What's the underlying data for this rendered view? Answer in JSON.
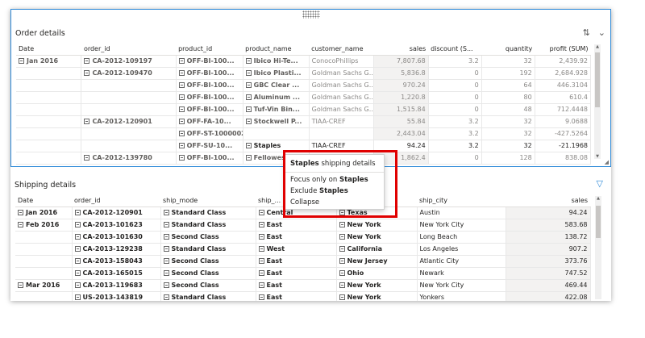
{
  "order_details": {
    "title": "Order details",
    "columns": [
      "Date",
      "order_id",
      "product_id",
      "product_name",
      "customer_name",
      "sales",
      "discount (S...",
      "quantity",
      "profit (SUM)"
    ],
    "rows": [
      {
        "date": "Jan 2016",
        "order_id": "CA-2012-109197",
        "product_id": "OFF-BI-100...",
        "product_name": "Ibico Hi-Te...",
        "customer_name": "ConocoPhillips",
        "sales": "7,807.68",
        "discount": "3.2",
        "quantity": "32",
        "profit": "2,439.92"
      },
      {
        "date": "",
        "order_id": "CA-2012-109470",
        "product_id": "OFF-BI-100...",
        "product_name": "Ibico Plasti...",
        "customer_name": "Goldman Sachs G...",
        "sales": "5,836.8",
        "discount": "0",
        "quantity": "192",
        "profit": "2,684.928"
      },
      {
        "date": "",
        "order_id": "",
        "product_id": "OFF-BI-100...",
        "product_name": "GBC Clear ...",
        "customer_name": "Goldman Sachs G...",
        "sales": "970.24",
        "discount": "0",
        "quantity": "64",
        "profit": "446.3104"
      },
      {
        "date": "",
        "order_id": "",
        "product_id": "OFF-BI-100...",
        "product_name": "Aluminum ...",
        "customer_name": "Goldman Sachs G...",
        "sales": "1,220.8",
        "discount": "0",
        "quantity": "80",
        "profit": "610.4"
      },
      {
        "date": "",
        "order_id": "",
        "product_id": "OFF-BI-100...",
        "product_name": "Tuf-Vin Bin...",
        "customer_name": "Goldman Sachs G...",
        "sales": "1,515.84",
        "discount": "0",
        "quantity": "48",
        "profit": "712.4448"
      },
      {
        "date": "",
        "order_id": "CA-2012-120901",
        "product_id": "OFF-FA-10...",
        "product_name": "Stockwell P...",
        "customer_name": "TIAA-CREF",
        "sales": "55.84",
        "discount": "3.2",
        "quantity": "32",
        "profit": "9.0688"
      },
      {
        "date": "",
        "order_id": "",
        "product_id": "OFF-ST-10000025",
        "product_name": "",
        "customer_name": "",
        "sales": "2,443.04",
        "discount": "3.2",
        "quantity": "32",
        "profit": "-427.5264"
      },
      {
        "date": "",
        "order_id": "",
        "product_id": "OFF-SU-10...",
        "product_name": "Staples",
        "customer_name": "TIAA-CREF",
        "sales": "94.24",
        "discount": "3.2",
        "quantity": "32",
        "profit": "-21.1968"
      },
      {
        "date": "",
        "order_id": "CA-2012-139780",
        "product_id": "OFF-BI-100...",
        "product_name": "Fellowes...",
        "customer_name": "",
        "sales": "1,862.4",
        "discount": "0",
        "quantity": "128",
        "profit": "838.08"
      }
    ]
  },
  "shipping_details": {
    "title": "Shipping details",
    "columns": [
      "Date",
      "order_id",
      "ship_mode",
      "ship_...",
      "",
      "ship_city",
      "sales"
    ],
    "rows": [
      {
        "date": "Jan 2016",
        "order_id": "CA-2012-120901",
        "ship_mode": "Standard Class",
        "region": "Central",
        "state": "Texas",
        "city": "Austin",
        "sales": "94.24"
      },
      {
        "date": "Feb 2016",
        "order_id": "CA-2013-101623",
        "ship_mode": "Standard Class",
        "region": "East",
        "state": "New York",
        "city": "New York City",
        "sales": "583.68"
      },
      {
        "date": "",
        "order_id": "CA-2013-101630",
        "ship_mode": "Second Class",
        "region": "East",
        "state": "New York",
        "city": "Long Beach",
        "sales": "138.72"
      },
      {
        "date": "",
        "order_id": "CA-2013-129238",
        "ship_mode": "Standard Class",
        "region": "West",
        "state": "California",
        "city": "Los Angeles",
        "sales": "907.2"
      },
      {
        "date": "",
        "order_id": "CA-2013-158043",
        "ship_mode": "Second Class",
        "region": "East",
        "state": "New Jersey",
        "city": "Atlantic City",
        "sales": "373.76"
      },
      {
        "date": "",
        "order_id": "CA-2013-165015",
        "ship_mode": "Second Class",
        "region": "East",
        "state": "Ohio",
        "city": "Newark",
        "sales": "747.52"
      },
      {
        "date": "Mar 2016",
        "order_id": "CA-2013-119683",
        "ship_mode": "Second Class",
        "region": "East",
        "state": "New York",
        "city": "New York City",
        "sales": "469.44"
      },
      {
        "date": "",
        "order_id": "US-2013-143819",
        "ship_mode": "Standard Class",
        "region": "East",
        "state": "New York",
        "city": "Yonkers",
        "sales": "422.08"
      }
    ]
  },
  "context_menu": {
    "header_bold": "Staples",
    "header_rest": " shipping details",
    "focus_prefix": "Focus only on ",
    "focus_bold": "Staples",
    "exclude_prefix": "Exclude ",
    "exclude_bold": "Staples",
    "collapse": "Collapse"
  },
  "colors": {
    "selection_border": "#2e8ad8",
    "highlight_box": "#e00000"
  }
}
